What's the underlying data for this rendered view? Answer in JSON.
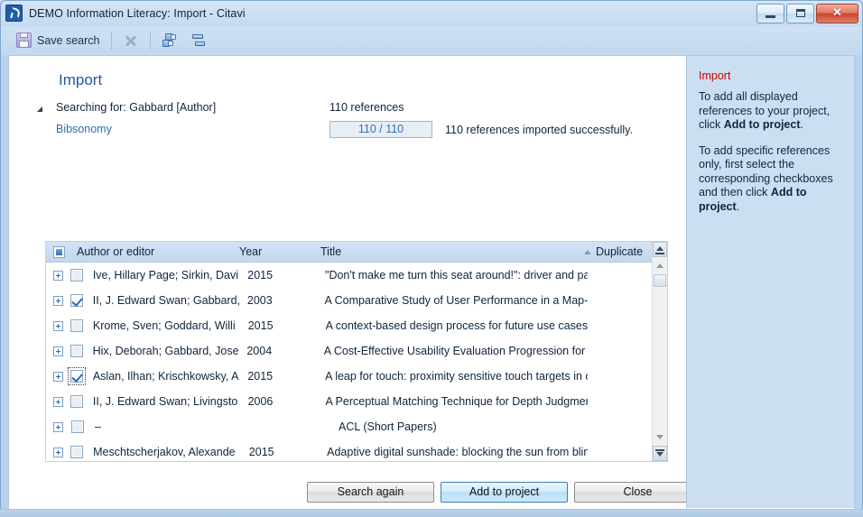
{
  "window": {
    "title": "DEMO Information Literacy: Import - Citavi",
    "app_icon": "citavi-logo-icon",
    "controls": {
      "minimize": "minimize-icon",
      "maximize": "maximize-icon",
      "close": "close-icon",
      "close_glyph": "✕"
    }
  },
  "toolbar": {
    "save_search_label": "Save search",
    "save_icon": "floppy-disk-icon",
    "cancel_icon": "cancel-x-icon",
    "duplicate_icon": "find-duplicates-icon",
    "split_icon": "split-view-icon"
  },
  "header": {
    "page_title": "Import",
    "collapse_toggle": "collapse-triangle-icon",
    "searching_for": "Searching for: Gabbard [Author]",
    "provider": "Bibsonomy",
    "reference_count": "110 references",
    "progress_value": "110 / 110",
    "import_status": "110 references imported successfully."
  },
  "sidebar": {
    "title": "Import",
    "title_color": "#cc0000",
    "paragraphs": [
      {
        "parts": [
          {
            "text": "To add all displayed references to your project, click ",
            "bold": false
          },
          {
            "text": "Add to project",
            "bold": true
          },
          {
            "text": ".",
            "bold": false
          }
        ]
      },
      {
        "parts": [
          {
            "text": "To add specific references only, first select the corresponding checkboxes and then click ",
            "bold": false
          },
          {
            "text": "Add to project",
            "bold": true
          },
          {
            "text": ".",
            "bold": false
          }
        ]
      }
    ]
  },
  "grid": {
    "select_all_state": "indeterminate",
    "columns": [
      {
        "key": "author",
        "label": "Author or editor"
      },
      {
        "key": "year",
        "label": "Year"
      },
      {
        "key": "title",
        "label": "Title"
      },
      {
        "key": "duplicate",
        "label": "Duplicate",
        "sort": "ascending",
        "sort_icon": "sort-ascending-icon"
      }
    ],
    "rows": [
      {
        "checked": false,
        "focused": false,
        "author": "Ive, Hillary Page; Sirkin, Davi",
        "year": "2015",
        "title": "\"Don't make me turn this seat around!\": driver and pass",
        "duplicate": ""
      },
      {
        "checked": true,
        "focused": false,
        "author": "II, J. Edward Swan; Gabbard,",
        "year": "2003",
        "title": "A Comparative Study of User Performance in a Map-Ba",
        "duplicate": ""
      },
      {
        "checked": false,
        "focused": false,
        "author": "Krome, Sven; Goddard, Willi",
        "year": "2015",
        "title": "A context-based design process for future use cases of",
        "duplicate": ""
      },
      {
        "checked": false,
        "focused": false,
        "author": "Hix, Deborah; Gabbard, Jose",
        "year": "2004",
        "title": "A Cost-Effective Usability Evaluation Progression for No",
        "duplicate": ""
      },
      {
        "checked": true,
        "focused": true,
        "author": "Aslan, Ilhan; Krischkowsky, A",
        "year": "2015",
        "title": "A leap for touch: proximity sensitive touch targets in car",
        "duplicate": ""
      },
      {
        "checked": false,
        "focused": false,
        "author": "II, J. Edward Swan; Livingsto",
        "year": "2006",
        "title": "A Perceptual Matching Technique for Depth Judgments",
        "duplicate": ""
      },
      {
        "checked": false,
        "focused": false,
        "author": "–",
        "year": "",
        "title": "ACL (Short Papers)",
        "duplicate": ""
      },
      {
        "checked": false,
        "focused": false,
        "author": "Meschtscherjakov, Alexande",
        "year": "2015",
        "title": "Adaptive digital sunshade: blocking the sun from blindi",
        "duplicate": ""
      }
    ],
    "scrollbar": {
      "top_button": "scroll-to-top-icon",
      "bottom_button": "scroll-to-bottom-icon",
      "up_arrow": "scroll-up-icon",
      "down_arrow": "scroll-down-icon"
    }
  },
  "buttons": {
    "search_again": "Search again",
    "add_to_project": "Add to project",
    "close": "Close"
  },
  "colors": {
    "accent_blue": "#2f6fb2",
    "title_blue": "#215a9c",
    "help_red": "#cc0000",
    "sidebar_bg": "#ccdff2",
    "window_chrome": "#c3d8ee"
  }
}
